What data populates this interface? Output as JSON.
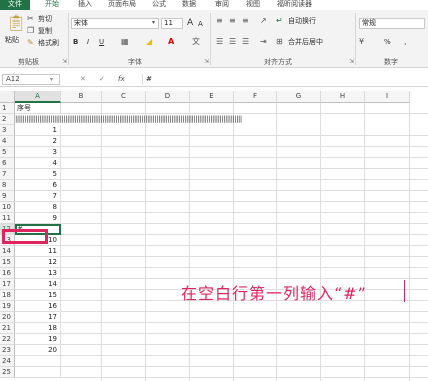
{
  "tabs": [
    "文件",
    "开始",
    "插入",
    "页面布局",
    "公式",
    "数据",
    "审阅",
    "视图",
    "福昕阅读器"
  ],
  "ribbon": {
    "paste_label": "粘贴",
    "cut_label": "剪切",
    "copy_label": "复制",
    "format_painter_label": "格式刷",
    "clipboard_group": "剪贴板",
    "font_name": "宋体",
    "font_size": "11",
    "bold": "B",
    "italic": "I",
    "underline": "U",
    "grow_font": "A",
    "shrink_font": "A",
    "font_group": "字体",
    "wrap_text_label": "自动换行",
    "merge_center_label": "合并后居中",
    "alignment_group": "对齐方式",
    "number_format": "常规",
    "percent": "%",
    "number_group": "数字"
  },
  "formula_bar": {
    "name_box": "A12",
    "fx": "fx",
    "value": "#"
  },
  "columns": [
    "A",
    "B",
    "C",
    "D",
    "E",
    "F",
    "G",
    "H",
    "I"
  ],
  "selected_column": "A",
  "rows": [
    {
      "n": "1",
      "a": "序号"
    },
    {
      "n": "2",
      "a": ""
    },
    {
      "n": "3",
      "a": "1"
    },
    {
      "n": "4",
      "a": "2"
    },
    {
      "n": "5",
      "a": "3"
    },
    {
      "n": "6",
      "a": "4"
    },
    {
      "n": "7",
      "a": "5"
    },
    {
      "n": "8",
      "a": "6"
    },
    {
      "n": "9",
      "a": "7"
    },
    {
      "n": "10",
      "a": "8"
    },
    {
      "n": "11",
      "a": "9"
    },
    {
      "n": "12",
      "a": "#"
    },
    {
      "n": "13",
      "a": "10"
    },
    {
      "n": "14",
      "a": "11"
    },
    {
      "n": "15",
      "a": "12"
    },
    {
      "n": "16",
      "a": "13"
    },
    {
      "n": "17",
      "a": "14"
    },
    {
      "n": "18",
      "a": "15"
    },
    {
      "n": "19",
      "a": "16"
    },
    {
      "n": "20",
      "a": "17"
    },
    {
      "n": "21",
      "a": "18"
    },
    {
      "n": "22",
      "a": "19"
    },
    {
      "n": "23",
      "a": "20"
    },
    {
      "n": "24",
      "a": ""
    },
    {
      "n": "25",
      "a": ""
    }
  ],
  "row2_marks": "||||||||||||||||||||||||||||||||||||||||||||||||||||||||||||||||||||||||||||||||||||||||||||||||||||||||||||||||||||||||||",
  "active_row": "12",
  "annotation": "在空白行第一列输入“#”",
  "colors": {
    "accent": "#217346",
    "annotation": "#e0245e"
  }
}
